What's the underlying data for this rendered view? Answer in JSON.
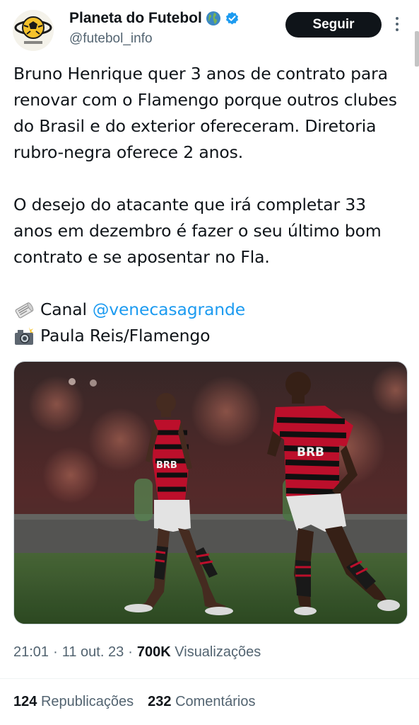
{
  "account": {
    "display_name": "Planeta do Futebol",
    "handle": "@futebol_info",
    "follow_label": "Seguir"
  },
  "tweet": {
    "paragraph1": "Bruno Henrique quer 3 anos de contrato para renovar com o Flamengo porque outros clubes do Brasil e do exterior ofereceram. Diretoria rubro-negra oferece 2 anos.",
    "paragraph2": "O desejo do atacante que irá completar 33 anos em dezembro é fazer o seu último bom contrato e se aposentar no Fla.",
    "channel_label": "Canal",
    "channel_mention": "@venecasagrande",
    "photo_credit": "Paula Reis/Flamengo",
    "jersey_text_left": "BRB",
    "jersey_text_right": "BRB"
  },
  "meta": {
    "time": "21:01",
    "sep": "·",
    "date": "11 out. 23",
    "views_count": "700K",
    "views_label": "Visualizações"
  },
  "stats": {
    "reposts_count": "124",
    "reposts_label": "Republicações",
    "comments_count": "232",
    "comments_label": "Comentários"
  },
  "colors": {
    "text": "#0f1419",
    "muted": "#536471",
    "link": "#1d9bf0",
    "follow_bg": "#0f1419",
    "verified": "#1d9bf0"
  },
  "icons": {
    "globe": "globe-icon",
    "verified": "verified-badge-icon",
    "more": "more-dots-icon",
    "newspaper": "newspaper-emoji-icon",
    "camera": "camera-flash-emoji-icon"
  }
}
